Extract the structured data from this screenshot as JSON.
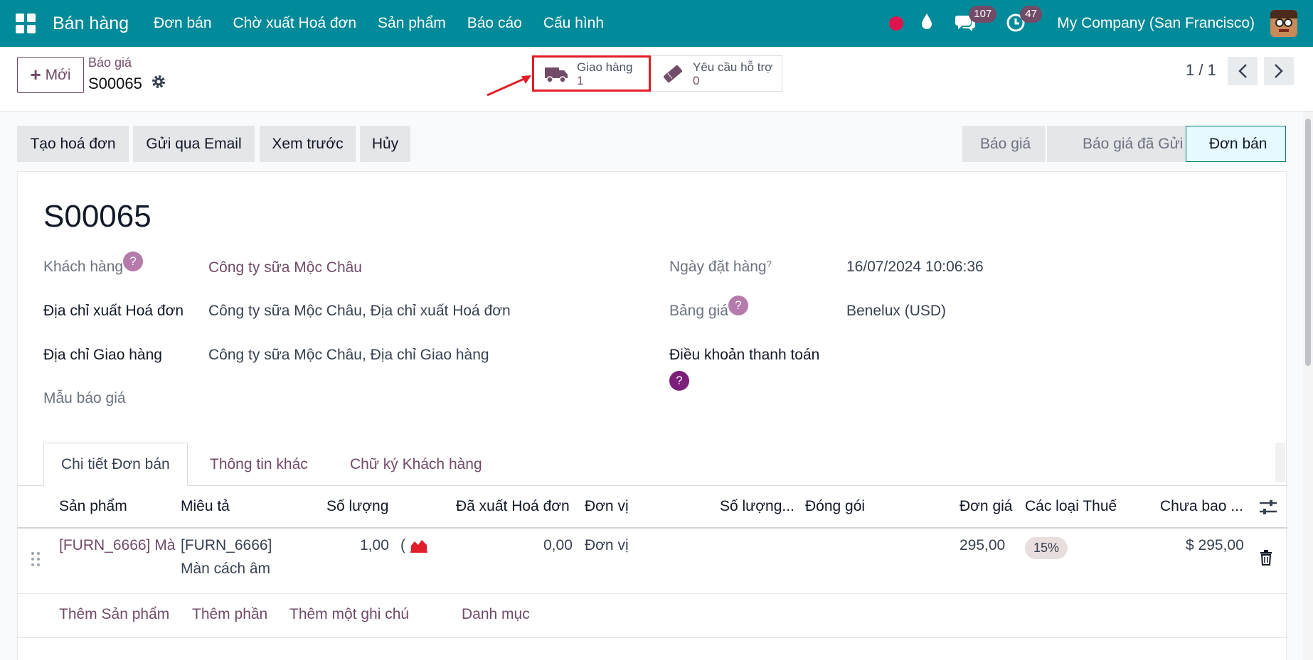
{
  "navbar": {
    "brand": "Bán hàng",
    "menu": [
      "Đơn bán",
      "Chờ xuất Hoá đơn",
      "Sản phẩm",
      "Báo cáo",
      "Cấu hình"
    ],
    "messages_count": "107",
    "activities_count": "47",
    "company": "My Company (San Francisco)",
    "icons": [
      "apps-icon",
      "record-dot-icon",
      "water-drop-icon",
      "chat-icon",
      "clock-icon",
      "avatar"
    ],
    "colors": {
      "bar": "#018a99",
      "badge": "#714b67",
      "record": "#e0144c"
    }
  },
  "control_panel": {
    "new_label": "Mới",
    "breadcrumb_parent": "Báo giá",
    "breadcrumb_current": "S00065",
    "smart_buttons": [
      {
        "label": "Giao hàng",
        "value": "1",
        "icon": "truck-icon"
      },
      {
        "label": "Yêu cầu hỗ trợ",
        "value": "0",
        "icon": "ticket-icon"
      }
    ],
    "pager": "1 / 1"
  },
  "actions": [
    "Tạo hoá đơn",
    "Gửi qua Email",
    "Xem trước",
    "Hủy"
  ],
  "status_stages": [
    {
      "label": "Báo giá",
      "active": false
    },
    {
      "label": "Báo giá đã Gửi",
      "active": false
    },
    {
      "label": "Đơn bán",
      "active": true
    }
  ],
  "form": {
    "title": "S00065",
    "left_fields": [
      {
        "label": "Khách hàng",
        "value": "Công ty sữa Mộc Châu"
      },
      {
        "label": "Địa chỉ xuất Hoá đơn",
        "value": "Công ty sữa Mộc Châu, Địa chỉ xuất Hoá đơn"
      },
      {
        "label": "Địa chỉ Giao hàng",
        "value": "Công ty sữa Mộc Châu, Địa chỉ Giao hàng"
      },
      {
        "label": "Mẫu báo giá",
        "value": ""
      }
    ],
    "right_fields": [
      {
        "label": "Ngày đặt hàng",
        "value": "16/07/2024 10:06:36"
      },
      {
        "label": "Bảng giá",
        "value": "Benelux (USD)"
      },
      {
        "label": "Điều khoản thanh toán",
        "value": ""
      }
    ],
    "help_mark": "?"
  },
  "tabs": [
    "Chi tiết Đơn bán",
    "Thông tin khác",
    "Chữ ký Khách hàng"
  ],
  "order_lines": {
    "columns": [
      "Sản phẩm",
      "Miêu tả",
      "Số lượng",
      "Đã xuất Hoá đơn",
      "Đơn vị",
      "Số lượng...",
      "Đóng gói",
      "Đơn giá",
      "Các loại Thuế",
      "Chưa bao ..."
    ],
    "rows": [
      {
        "product": "[FURN_6666] Mà",
        "description_line1": "[FURN_6666]",
        "description_line2": "Màn cách âm",
        "quantity": "1,00",
        "qty_suffix": "(",
        "invoiced": "0,00",
        "uom": "Đơn vị",
        "unit_price": "295,00",
        "tax": "15%",
        "subtotal": "$ 295,00"
      }
    ],
    "add_links": [
      "Thêm Sản phẩm",
      "Thêm phần",
      "Thêm một ghi chú",
      "Danh mục"
    ]
  }
}
